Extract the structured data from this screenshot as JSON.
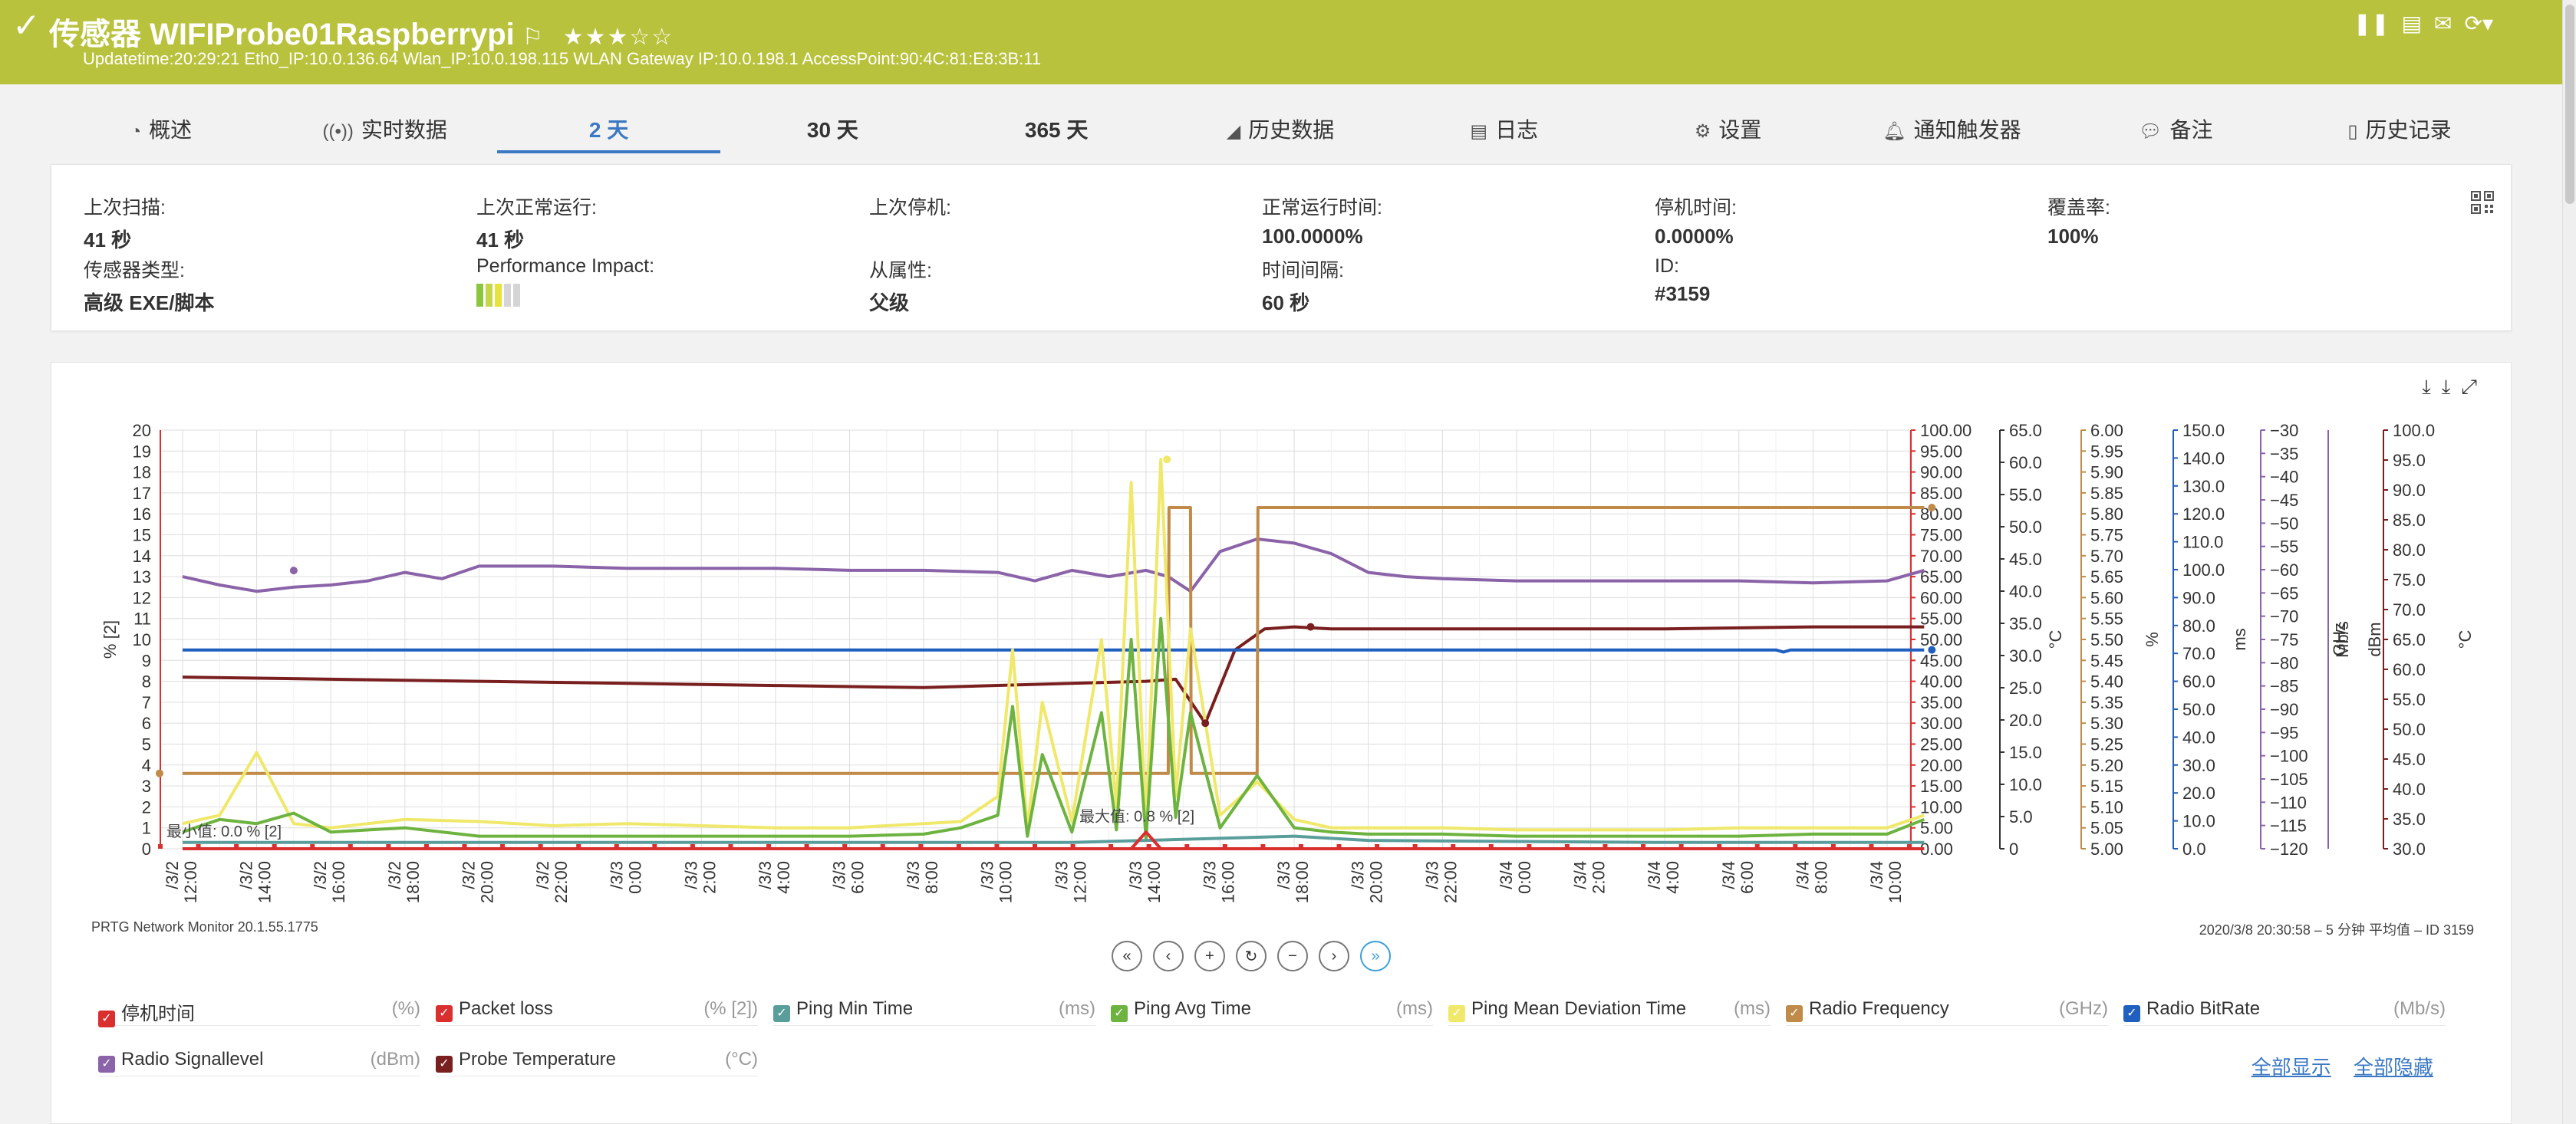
{
  "header": {
    "title": "传感器 WIFIProbe01Raspberrypi",
    "stars": "★★★☆☆",
    "meta": "Updatetime:20:29:21 Eth0_IP:10.0.136.64 Wlan_IP:10.0.198.115 WLAN Gateway IP:10.0.198.1 AccessPoint:90:4C:81:E8:3B:11"
  },
  "tabs": [
    {
      "label": "概述",
      "icon": "gauge-icon"
    },
    {
      "label": "实时数据",
      "icon": "live-icon"
    },
    {
      "label": "2  天",
      "icon": ""
    },
    {
      "label": "30 天",
      "icon": ""
    },
    {
      "label": "365 天",
      "icon": ""
    },
    {
      "label": "历史数据",
      "icon": "area-chart-icon"
    },
    {
      "label": "日志",
      "icon": "log-icon"
    },
    {
      "label": "设置",
      "icon": "gear-icon"
    },
    {
      "label": "通知触发器",
      "icon": "bell-icon"
    },
    {
      "label": "备注",
      "icon": "comment-icon"
    },
    {
      "label": "历史记录",
      "icon": "history-icon"
    }
  ],
  "info": {
    "last_scan_label": "上次扫描:",
    "last_scan": "41 秒",
    "last_up_label": "上次正常运行:",
    "last_up": "41 秒",
    "last_down_label": "上次停机:",
    "last_down": "",
    "uptime_label": "正常运行时间:",
    "uptime": "100.0000%",
    "downtime_label": "停机时间:",
    "downtime": "0.0000%",
    "coverage_label": "覆盖率:",
    "coverage": "100%",
    "type_label": "传感器类型:",
    "type": "高级 EXE/脚本",
    "perf_label": "Performance Impact:",
    "dependency_label": "从属性:",
    "dependency": "父级",
    "interval_label": "时间间隔:",
    "interval": "60 秒",
    "id_label": "ID:",
    "id": "#3159",
    "perf_colors": [
      "#8cc63f",
      "#c7d54b",
      "#e7e33b",
      "#d5d5d5",
      "#d5d5d5"
    ]
  },
  "footer": {
    "left": "PRTG Network Monitor 20.1.55.1775",
    "right": "2020/3/8 20:30:58 – 5 分钟 平均值 – ID 3159"
  },
  "pager": [
    "«",
    "‹",
    "+",
    "↻",
    "−",
    "›",
    "»"
  ],
  "legend": [
    {
      "name": "停机时间",
      "unit": "(%)",
      "color": "#d92f2f"
    },
    {
      "name": "Packet loss",
      "unit": "(% [2])",
      "color": "#d92f2f"
    },
    {
      "name": "Ping Min Time",
      "unit": "(ms)",
      "color": "#5a9e9c"
    },
    {
      "name": "Ping Avg Time",
      "unit": "(ms)",
      "color": "#6db33f"
    },
    {
      "name": "Ping Mean Deviation Time",
      "unit": "(ms)",
      "color": "#f0e86a"
    },
    {
      "name": "Radio Frequency",
      "unit": "(GHz)",
      "color": "#c08a48"
    },
    {
      "name": "Radio BitRate",
      "unit": "(Mb/s)",
      "color": "#1f5fbf"
    },
    {
      "name": "Radio Signallevel",
      "unit": "(dBm)",
      "color": "#8a63a8"
    },
    {
      "name": "Probe Temperature",
      "unit": "(°C)",
      "color": "#7a1f1f"
    }
  ],
  "legend_links": {
    "show_all": "全部显示",
    "hide_all": "全部隐藏"
  },
  "chart_data": {
    "type": "line",
    "x": [
      "/3/2 12:00",
      "/3/2 14:00",
      "/3/2 16:00",
      "/3/2 18:00",
      "/3/2 20:00",
      "/3/2 22:00",
      "/3/3 0:00",
      "/3/3 2:00",
      "/3/3 4:00",
      "/3/3 6:00",
      "/3/3 8:00",
      "/3/3 10:00",
      "/3/3 12:00",
      "/3/3 14:00",
      "/3/3 16:00",
      "/3/3 18:00",
      "/3/3 20:00",
      "/3/3 22:00",
      "/3/4 0:00",
      "/3/4 2:00",
      "/3/4 4:00",
      "/3/4 6:00",
      "/3/4 8:00",
      "/3/4 10:00"
    ],
    "axes": [
      {
        "label": "% [2]",
        "side": "left",
        "ticks": [
          "0",
          "1",
          "2",
          "3",
          "4",
          "5",
          "6",
          "7",
          "8",
          "9",
          "10",
          "11",
          "12",
          "13",
          "14",
          "15",
          "16",
          "17",
          "18",
          "19",
          "20"
        ],
        "color": "#d92f2f"
      },
      {
        "label": "°C",
        "side": "right",
        "ticks": [
          "0.00",
          "5.00",
          "10.00",
          "15.00",
          "20.00",
          "25.00",
          "30.00",
          "35.00",
          "40.00",
          "45.00",
          "50.00",
          "55.00",
          "60.00",
          "65.00",
          "70.00",
          "75.00",
          "80.00",
          "85.00",
          "90.00",
          "95.00",
          "100.00"
        ],
        "color": "#d92f2f"
      },
      {
        "label": "%",
        "side": "right",
        "ticks": [
          "0",
          "5.0",
          "10.0",
          "15.0",
          "20.0",
          "25.0",
          "30.0",
          "35.0",
          "40.0",
          "45.0",
          "50.0",
          "55.0",
          "60.0",
          "65.0"
        ],
        "color": "#333333"
      },
      {
        "label": "ms",
        "side": "right",
        "ticks": [
          "5.00",
          "5.05",
          "5.10",
          "5.15",
          "5.20",
          "5.25",
          "5.30",
          "5.35",
          "5.40",
          "5.45",
          "5.50",
          "5.55",
          "5.60",
          "5.65",
          "5.70",
          "5.75",
          "5.80",
          "5.85",
          "5.90",
          "5.95",
          "6.00"
        ],
        "color": "#c08a48"
      },
      {
        "label": "GHz",
        "side": "right",
        "ticks": [
          "0.0",
          "10.0",
          "20.0",
          "30.0",
          "40.0",
          "50.0",
          "60.0",
          "70.0",
          "80.0",
          "90.0",
          "100.0",
          "110.0",
          "120.0",
          "130.0",
          "140.0",
          "150.0"
        ],
        "color": "#1f5fbf"
      },
      {
        "label": "Mb/s",
        "side": "right",
        "ticks": [
          "−120",
          "−115",
          "−110",
          "−105",
          "−100",
          "−95",
          "−90",
          "−85",
          "−80",
          "−75",
          "−70",
          "−65",
          "−60",
          "−55",
          "−50",
          "−45",
          "−40",
          "−35",
          "−30"
        ],
        "color": "#8a63a8"
      },
      {
        "label": "dBm",
        "side": "right",
        "ticks": [],
        "color": "#8a63a8"
      },
      {
        "label": "°C",
        "side": "right",
        "ticks": [
          "30.0",
          "35.0",
          "40.0",
          "45.0",
          "50.0",
          "55.0",
          "60.0",
          "65.0",
          "70.0",
          "75.0",
          "80.0",
          "85.0",
          "90.0",
          "95.0",
          "100.0"
        ],
        "color": "#7a1f1f"
      }
    ],
    "annotations": [
      "最小值: 0.0 % [2]",
      "最大值: 0.8 % [2]"
    ],
    "ylim": [
      0,
      20
    ],
    "grid": true,
    "series": [
      {
        "name": "Radio Signallevel",
        "color": "#8a63a8",
        "x": [
          0,
          0.5,
          1,
          1.5,
          2,
          2.5,
          3,
          3.5,
          4,
          5,
          6,
          7,
          8,
          9,
          10,
          11,
          11.5,
          12,
          12.5,
          13,
          13.3,
          13.6,
          14,
          14.5,
          15,
          15.5,
          16,
          16.5,
          17,
          18,
          19,
          20,
          21,
          22,
          23,
          23.5
        ],
        "values": [
          13,
          12.6,
          12.3,
          12.5,
          12.6,
          12.8,
          13.2,
          12.9,
          13.5,
          13.5,
          13.4,
          13.4,
          13.4,
          13.3,
          13.3,
          13.2,
          12.8,
          13.3,
          13.0,
          13.3,
          13.0,
          12.3,
          14.2,
          14.8,
          14.6,
          14.1,
          13.2,
          13.0,
          12.9,
          12.8,
          12.8,
          12.8,
          12.8,
          12.7,
          12.8,
          13.3
        ]
      },
      {
        "name": "Probe Temperature",
        "color": "#7a1f1f",
        "x": [
          0,
          2,
          4,
          6,
          8,
          10,
          12,
          13,
          13.4,
          13.8,
          14.2,
          14.6,
          15,
          15.5,
          16,
          18,
          20,
          22,
          23.5
        ],
        "values": [
          8.2,
          8.1,
          8.0,
          7.9,
          7.8,
          7.7,
          7.9,
          8.0,
          8.1,
          6.0,
          9.5,
          10.5,
          10.6,
          10.5,
          10.5,
          10.5,
          10.5,
          10.6,
          10.6
        ]
      },
      {
        "name": "Radio BitRate",
        "color": "#1f5fbf",
        "x": [
          0,
          21.5,
          21.6,
          21.7,
          23.5
        ],
        "values": [
          9.5,
          9.5,
          9.4,
          9.5,
          9.5
        ]
      },
      {
        "name": "Radio Frequency",
        "color": "#c08a48",
        "x": [
          0,
          13.3,
          13.31,
          13.6,
          13.61,
          14.5,
          14.51,
          16.2,
          16.21,
          23.5
        ],
        "values": [
          3.6,
          3.6,
          16.3,
          16.3,
          3.6,
          3.6,
          16.3,
          16.3,
          16.3,
          16.3
        ]
      },
      {
        "name": "Ping Mean Deviation Time",
        "color": "#f0e86a",
        "x": [
          0,
          0.5,
          1,
          1.5,
          2,
          3,
          4,
          5,
          6,
          7,
          8,
          9,
          10,
          10.5,
          11,
          11.2,
          11.4,
          11.6,
          12,
          12.4,
          12.6,
          12.8,
          13.0,
          13.2,
          13.4,
          13.6,
          14,
          14.5,
          15,
          15.5,
          16,
          17,
          18,
          19,
          20,
          21,
          22,
          23,
          23.5
        ],
        "values": [
          1.2,
          1.6,
          4.6,
          1.2,
          1.0,
          1.4,
          1.3,
          1.1,
          1.2,
          1.1,
          1.0,
          1.0,
          1.2,
          1.3,
          2.5,
          9.5,
          1.0,
          7.0,
          1.3,
          10.0,
          2.0,
          17.5,
          1.0,
          18.6,
          2.5,
          10.5,
          1.6,
          3.2,
          1.4,
          1.0,
          1.0,
          1.0,
          0.9,
          0.9,
          0.9,
          1.0,
          1.0,
          1.0,
          1.6
        ]
      },
      {
        "name": "Ping Avg Time",
        "color": "#6db33f",
        "x": [
          0,
          0.5,
          1,
          1.5,
          2,
          3,
          4,
          5,
          6,
          7,
          8,
          9,
          10,
          10.5,
          11,
          11.2,
          11.4,
          11.6,
          12,
          12.4,
          12.6,
          12.8,
          13.0,
          13.2,
          13.4,
          13.6,
          14,
          14.5,
          15,
          15.5,
          16,
          17,
          18,
          19,
          20,
          21,
          22,
          23,
          23.5
        ],
        "values": [
          0.8,
          1.4,
          1.2,
          1.7,
          0.8,
          1.0,
          0.6,
          0.6,
          0.6,
          0.6,
          0.6,
          0.6,
          0.7,
          1.0,
          1.6,
          6.8,
          0.6,
          4.5,
          0.8,
          6.5,
          0.9,
          10.0,
          0.5,
          11.0,
          1.5,
          6.5,
          1.0,
          3.5,
          1.0,
          0.8,
          0.7,
          0.7,
          0.6,
          0.6,
          0.6,
          0.6,
          0.7,
          0.7,
          1.4
        ]
      },
      {
        "name": "Ping Min Time",
        "color": "#5a9e9c",
        "x": [
          0,
          4,
          8,
          12,
          13,
          14,
          15,
          16,
          20,
          23.5
        ],
        "values": [
          0.3,
          0.3,
          0.3,
          0.3,
          0.4,
          0.5,
          0.6,
          0.4,
          0.3,
          0.3
        ]
      },
      {
        "name": "Packet loss",
        "color": "#d92f2f",
        "x": [
          0,
          12.8,
          13.0,
          13.2,
          23.5
        ],
        "values": [
          0,
          0,
          0.8,
          0,
          0
        ]
      },
      {
        "name": "停机时间",
        "color": "#d92f2f",
        "x": [
          0,
          23.5
        ],
        "values": [
          0,
          0
        ]
      }
    ]
  }
}
